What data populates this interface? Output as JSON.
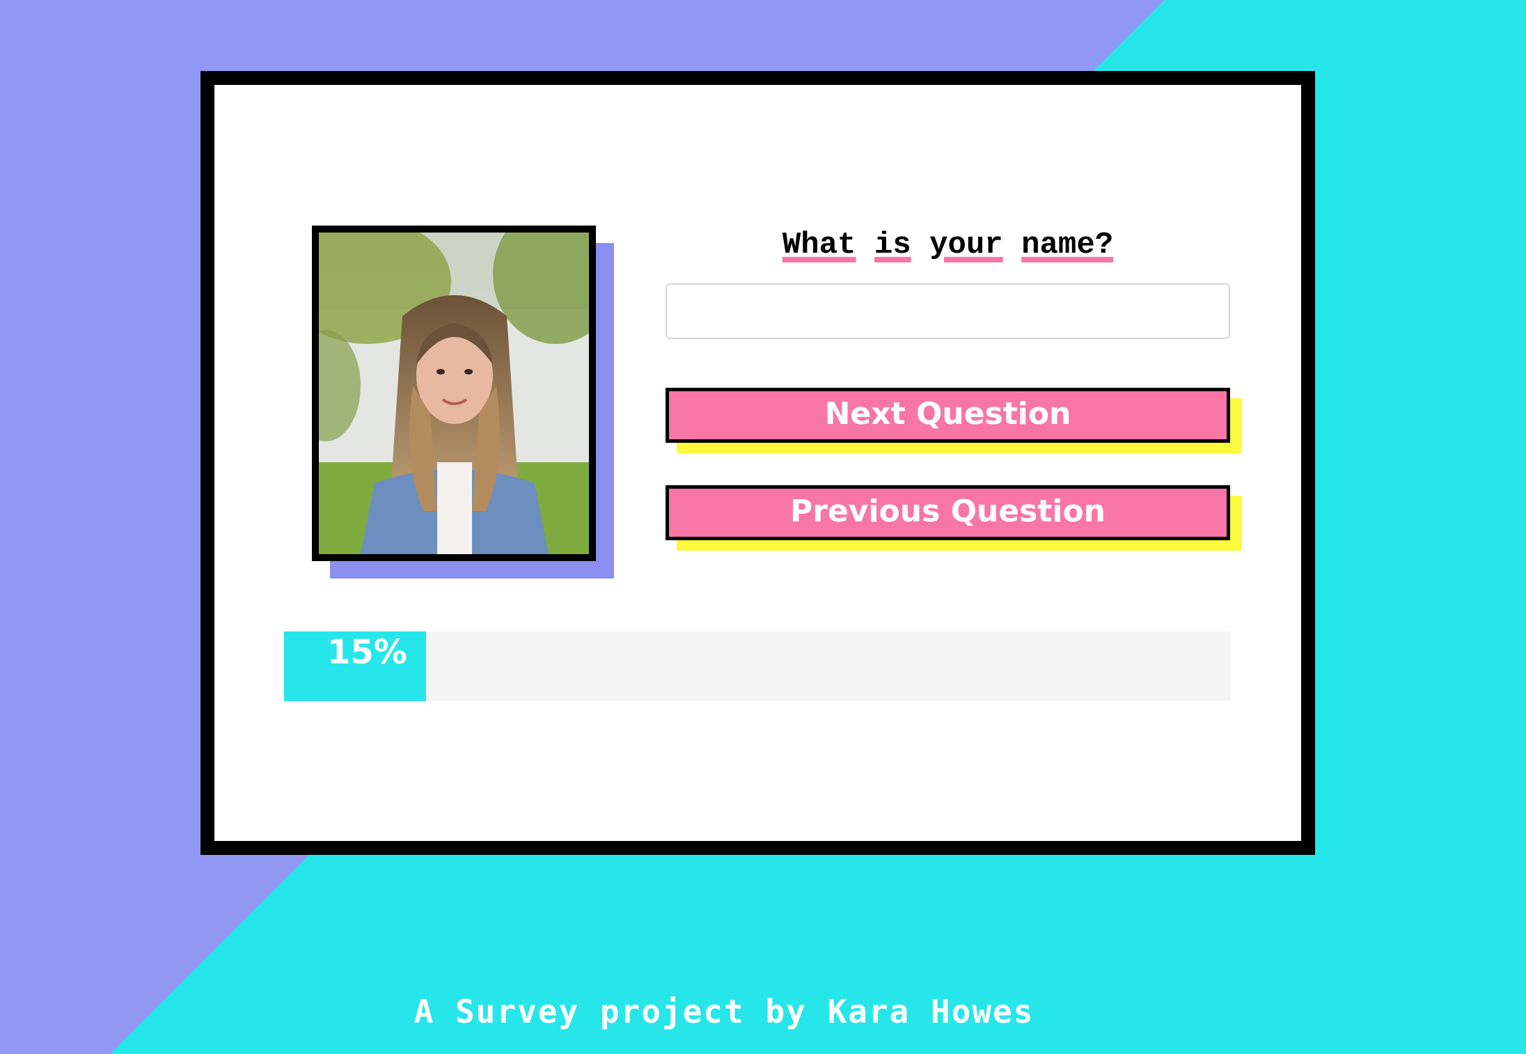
{
  "colors": {
    "background_cyan": "#26e6e9",
    "background_purple": "#9198f3",
    "card_border": "#000000",
    "button_pink": "#f776a6",
    "button_shadow_yellow": "#fbf93c",
    "photo_shadow_purple": "#8b8ff0",
    "progress_track": "#f4f4f4",
    "progress_fill": "#26e6e9"
  },
  "question": {
    "words": [
      "What",
      "is",
      "your",
      "name?"
    ]
  },
  "answer_input": {
    "value": "",
    "placeholder": ""
  },
  "buttons": {
    "next_label": "Next Question",
    "previous_label": "Previous Question"
  },
  "progress": {
    "label": "15%",
    "fraction": 0.15
  },
  "footer": {
    "text": "A Survey project by Kara Howes"
  }
}
